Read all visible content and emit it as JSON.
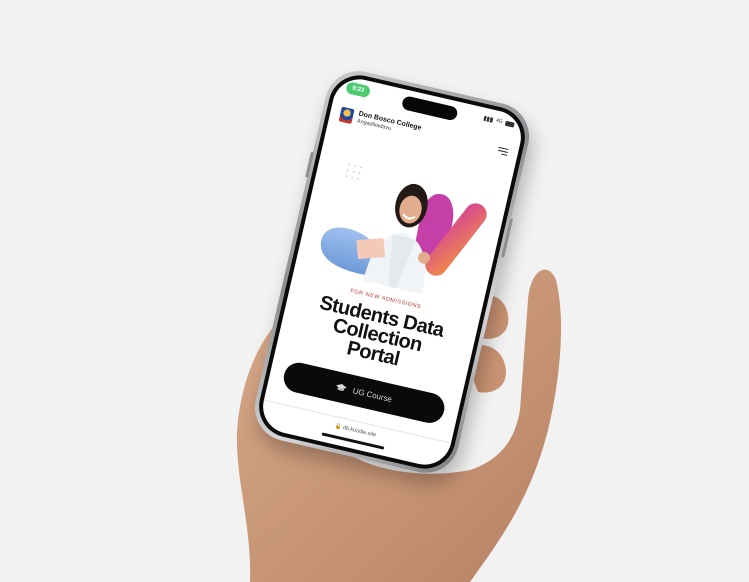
{
  "status_bar": {
    "time": "9:23",
    "network": "4G"
  },
  "header": {
    "brand_name": "Don Bosco College",
    "brand_location": "Angadikadavu"
  },
  "hero": {
    "kicker": "FOR NEW ADMISSIONS",
    "title_line1": "Students Data",
    "title_line2": "Collection",
    "title_line3": "Portal"
  },
  "cta": {
    "label": "UG Course"
  },
  "footer": {
    "url": "db.koodle.site"
  },
  "colors": {
    "background": "#f2f2f2",
    "accent_red": "#c0392b",
    "status_green": "#4ecb71",
    "cta_black": "#0a0a0a",
    "gradient_pink": "#d64592",
    "gradient_orange": "#f08a4b",
    "blob_blue": "#6f9ad8"
  },
  "icons": [
    "school-logo-icon",
    "menu-icon",
    "graduation-cap-icon",
    "lock-icon"
  ]
}
